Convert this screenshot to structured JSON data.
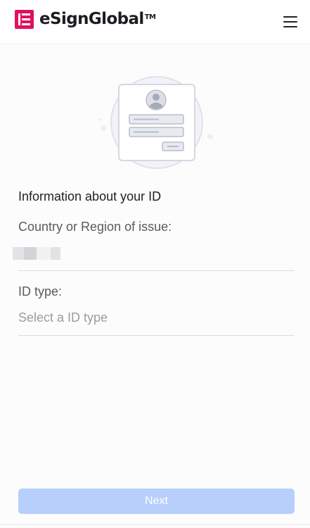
{
  "header": {
    "brand": "eSignGlobal",
    "trademark": "TM",
    "brand_color": "#e0115f",
    "logo_icon": "esignglobal-logo-icon",
    "menu_icon": "hamburger-menu-icon"
  },
  "illustration": {
    "icon": "id-card-illustration"
  },
  "form": {
    "section_title": "Information about your ID",
    "country_label": "Country or Region of issue:",
    "id_type_label": "ID type:",
    "id_type_placeholder": "Select a ID type"
  },
  "footer": {
    "next_label": "Next",
    "next_color": "#b7cffa"
  }
}
